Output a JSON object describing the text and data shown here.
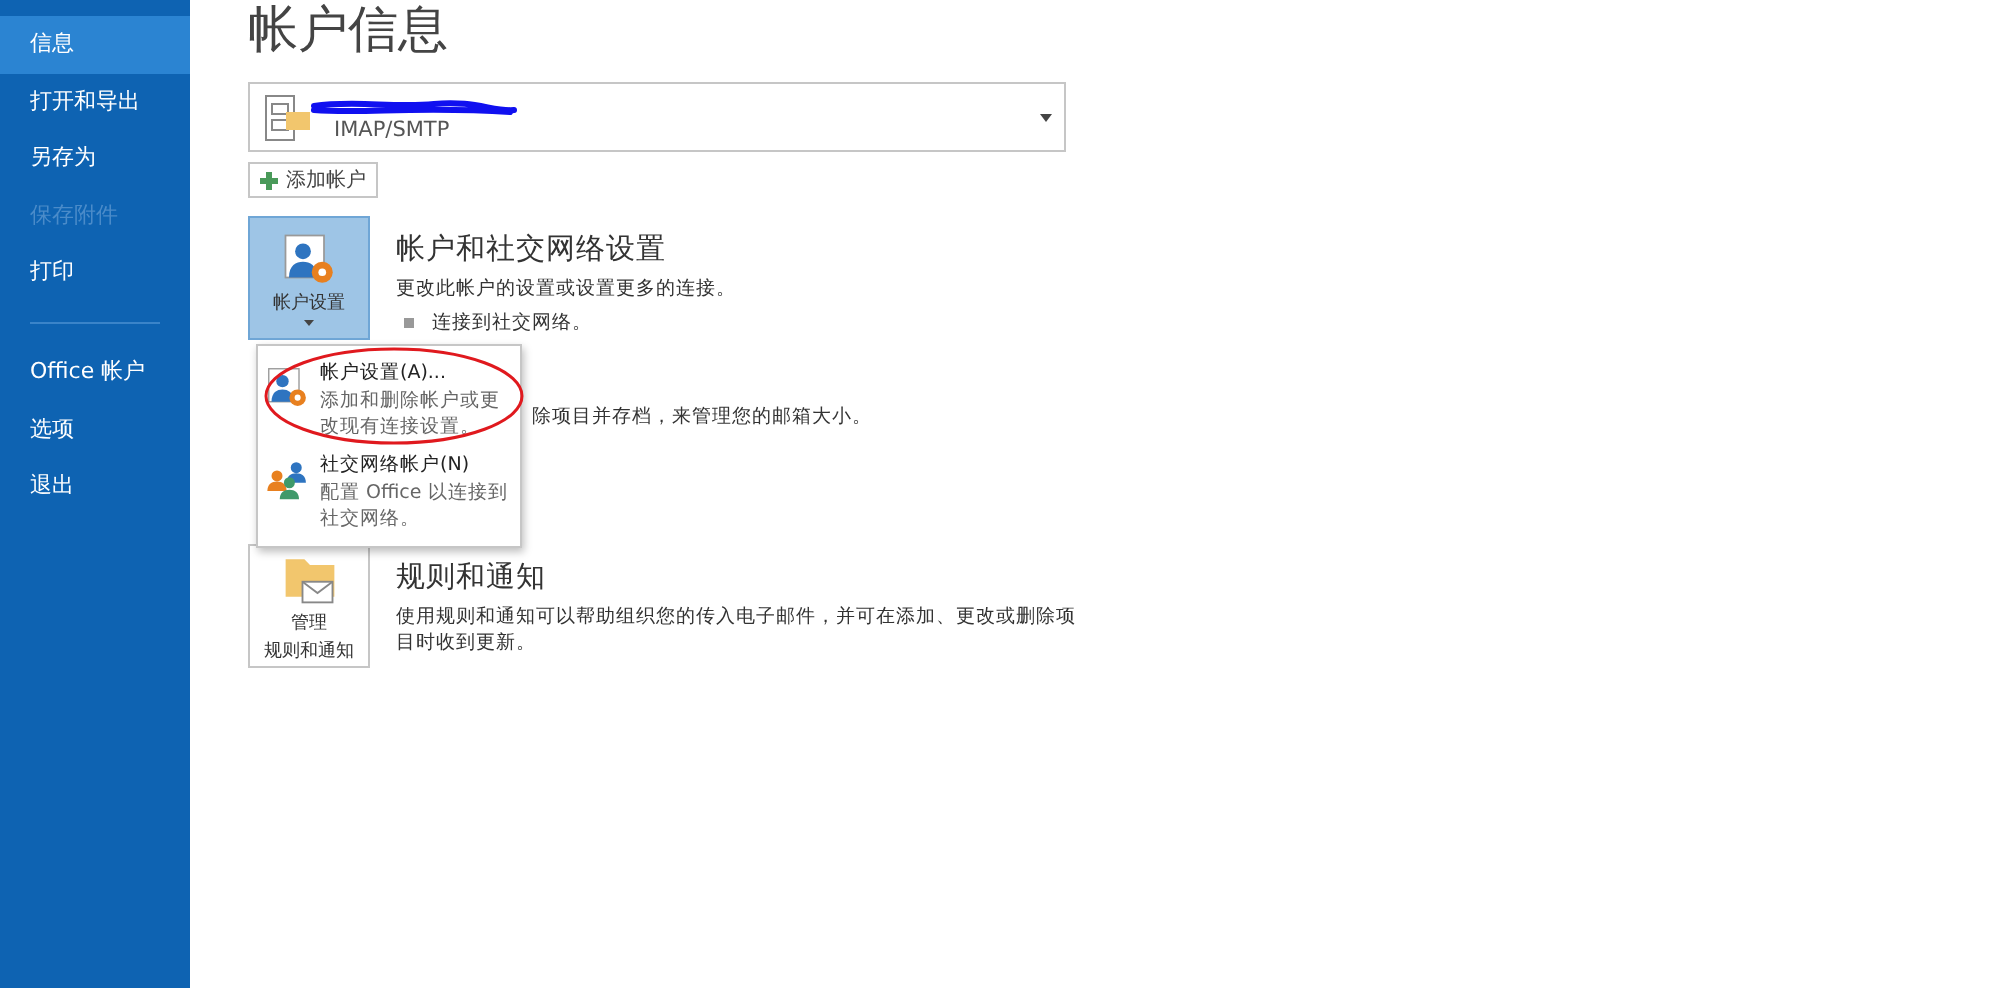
{
  "sidebar": {
    "items": [
      {
        "label": "信息",
        "selected": true,
        "disabled": false
      },
      {
        "label": "打开和导出",
        "selected": false,
        "disabled": false
      },
      {
        "label": "另存为",
        "selected": false,
        "disabled": false
      },
      {
        "label": "保存附件",
        "selected": false,
        "disabled": true
      },
      {
        "label": "打印",
        "selected": false,
        "disabled": false
      }
    ],
    "footer_items": [
      {
        "label": "Office 帐户",
        "selected": false,
        "disabled": false
      },
      {
        "label": "选项",
        "selected": false,
        "disabled": false
      },
      {
        "label": "退出",
        "selected": false,
        "disabled": false
      }
    ]
  },
  "title": "帐户信息",
  "account": {
    "type": "IMAP/SMTP"
  },
  "add_account": "添加帐户",
  "sections": [
    {
      "kind": "settings",
      "tile_label": [
        "帐户设置"
      ],
      "selected": true,
      "heading": "帐户和社交网络设置",
      "description": "更改此帐户的设置或设置更多的连接。",
      "bullet": "连接到社交网络。"
    },
    {
      "kind": "covered",
      "description": "除项目并存档，来管理您的邮箱大小。"
    },
    {
      "kind": "rules",
      "tile_label": [
        "管理",
        "规则和通知"
      ],
      "selected": false,
      "heading": "规则和通知",
      "description": "使用规则和通知可以帮助组织您的传入电子邮件，并可在添加、更改或删除项目时收到更新。"
    }
  ],
  "menu": {
    "items": [
      {
        "kind": "account",
        "title": "帐户设置(A)...",
        "description": "添加和删除帐户或更改现有连接设置。"
      },
      {
        "kind": "social",
        "title": "社交网络帐户(N)",
        "description": "配置 Office 以连接到社交网络。"
      }
    ]
  }
}
